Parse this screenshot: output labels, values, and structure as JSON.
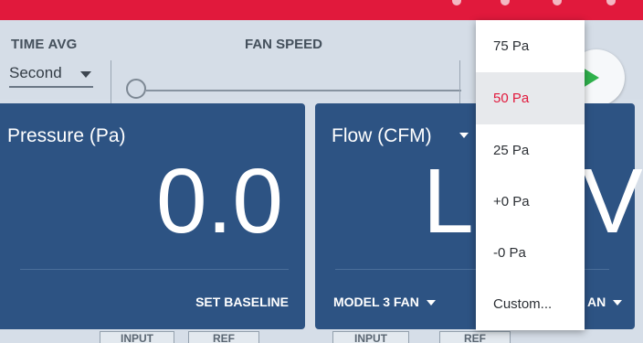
{
  "toolbar": {
    "time_avg_label": "TIME AVG",
    "time_avg_value": "Second",
    "fan_speed_label": "FAN SPEED"
  },
  "panels": {
    "pressure": {
      "title": "Pressure (Pa)",
      "value": "0.0",
      "action": "SET BASELINE"
    },
    "flow": {
      "title": "Flow (CFM)",
      "value_left": "L",
      "value_right": "V",
      "model": "MODEL 3 FAN",
      "right_selector": "AN"
    }
  },
  "bottom_tabs": [
    "INPUT",
    "REF",
    "INPUT",
    "REF"
  ],
  "menu": {
    "items": [
      "75 Pa",
      "50 Pa",
      "25 Pa",
      "+0 Pa",
      "-0 Pa",
      "Custom..."
    ],
    "selected": "50 Pa"
  },
  "colors": {
    "accent_red": "#e1193c",
    "panel_blue": "#2d5383",
    "play_green": "#2fb24c"
  },
  "icons": {
    "play": "play-icon",
    "dropdown": "chevron-down-icon"
  }
}
